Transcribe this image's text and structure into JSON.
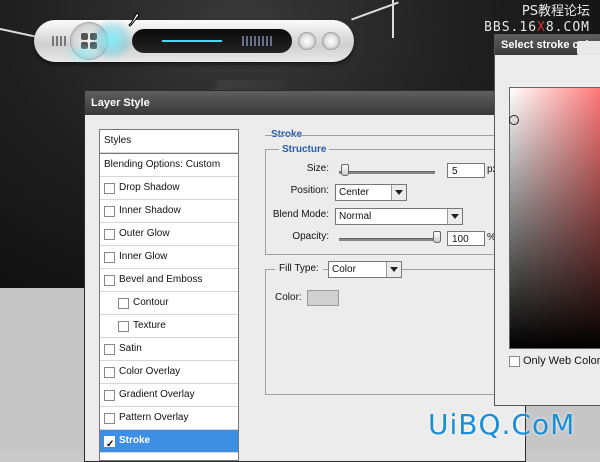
{
  "watermark": {
    "line1": "PS教程论坛",
    "line2_a": "BBS.16",
    "line2_b": "X",
    "line2_c": "8.COM"
  },
  "layer_style": {
    "title": "Layer Style",
    "styles_list": [
      {
        "label": "Styles",
        "type": "header"
      },
      {
        "label": "Blending Options: Custom",
        "type": "header"
      },
      {
        "label": "Drop Shadow",
        "checked": false,
        "indent": 0
      },
      {
        "label": "Inner Shadow",
        "checked": false,
        "indent": 0
      },
      {
        "label": "Outer Glow",
        "checked": false,
        "indent": 0
      },
      {
        "label": "Inner Glow",
        "checked": false,
        "indent": 0
      },
      {
        "label": "Bevel and Emboss",
        "checked": false,
        "indent": 0
      },
      {
        "label": "Contour",
        "checked": false,
        "indent": 1
      },
      {
        "label": "Texture",
        "checked": false,
        "indent": 1
      },
      {
        "label": "Satin",
        "checked": false,
        "indent": 0
      },
      {
        "label": "Color Overlay",
        "checked": false,
        "indent": 0
      },
      {
        "label": "Gradient Overlay",
        "checked": false,
        "indent": 0
      },
      {
        "label": "Pattern Overlay",
        "checked": false,
        "indent": 0
      },
      {
        "label": "Stroke",
        "checked": true,
        "indent": 0,
        "selected": true
      }
    ],
    "stroke": {
      "section_title": "Stroke",
      "structure_title": "Structure",
      "size_label": "Size:",
      "size_value": "5",
      "size_unit": "px",
      "position_label": "Position:",
      "position_value": "Center",
      "blend_label": "Blend Mode:",
      "blend_value": "Normal",
      "opacity_label": "Opacity:",
      "opacity_value": "100",
      "opacity_unit": "%",
      "fill_type_label": "Fill Type:",
      "fill_type_value": "Color",
      "color_label": "Color:"
    }
  },
  "picker": {
    "title": "Select stroke color",
    "only_web_colors": "Only Web Colors"
  },
  "footer_watermark": "UiBQ.CoM",
  "colors": {
    "accent": "#3d8fe4",
    "section_title": "#2a5db0",
    "glow": "#48d6f5"
  }
}
